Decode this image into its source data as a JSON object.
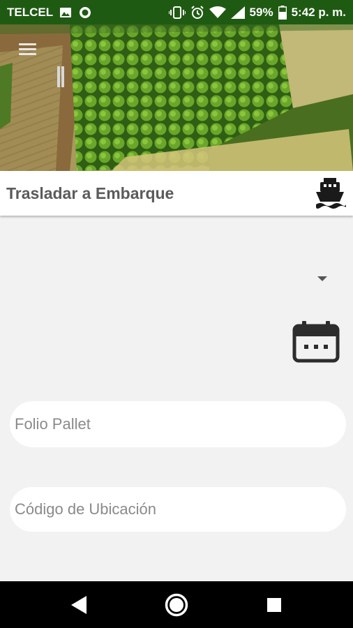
{
  "status_bar": {
    "carrier": "TELCEL",
    "battery": "59%",
    "time": "5:42 p. m.",
    "icons": [
      "image-icon",
      "sync-icon",
      "vibrate-icon",
      "alarm-icon",
      "wifi-icon",
      "signal-icon",
      "battery-icon"
    ]
  },
  "header": {
    "menu_icon": "hamburger-menu-icon"
  },
  "title_bar": {
    "title": "Trasladar a Embarque",
    "icon": "ship-icon"
  },
  "form": {
    "dropdown": {
      "value": "",
      "icon": "dropdown-arrow-icon"
    },
    "date": {
      "value": "",
      "icon": "calendar-icon"
    },
    "folio_pallet": {
      "value": "",
      "placeholder": "Folio Pallet"
    },
    "codigo_ubicacion": {
      "value": "",
      "placeholder": "Código de Ubicación"
    }
  },
  "nav_bar": {
    "buttons": [
      "back-icon",
      "home-icon",
      "recents-icon"
    ]
  },
  "colors": {
    "status_bar": "#1f5a12",
    "background": "#f2f2f2",
    "title_text": "#5b5b5b",
    "icon_dark": "#2d2d2d"
  }
}
